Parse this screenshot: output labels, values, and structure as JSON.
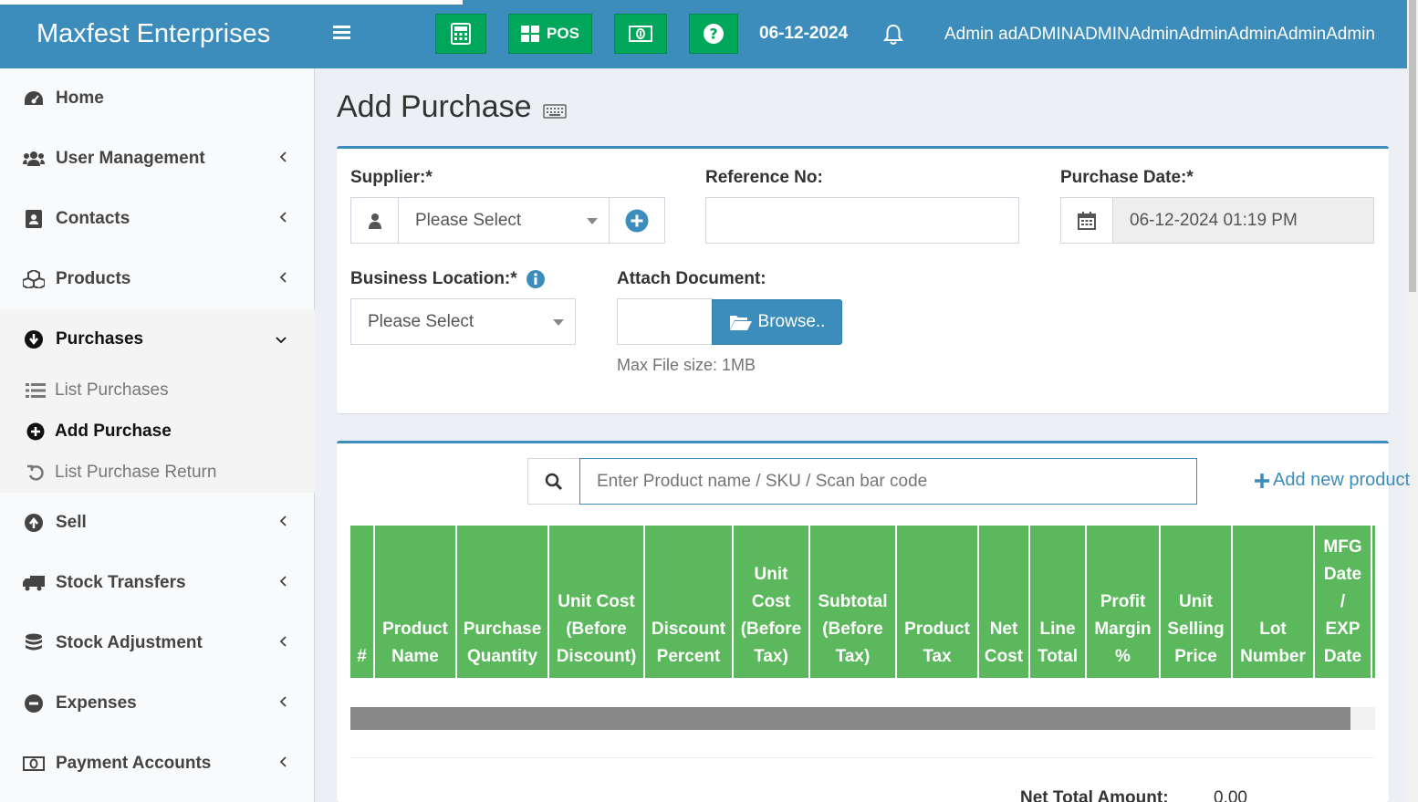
{
  "header": {
    "brand": "Maxfest Enterprises",
    "pos_label": "POS",
    "date": "06-12-2024",
    "user": "Admin adADMINADMINAdminAdminAdminAdminAdmin",
    "accent": "#3c8dbc",
    "button_color": "#00a65a"
  },
  "sidebar": {
    "items": [
      {
        "label": "Home",
        "icon": "dashboard-icon"
      },
      {
        "label": "User Management",
        "icon": "users-icon"
      },
      {
        "label": "Contacts",
        "icon": "address-book-icon"
      },
      {
        "label": "Products",
        "icon": "cubes-icon"
      },
      {
        "label": "Purchases",
        "icon": "arrow-circle-down-icon"
      },
      {
        "label": "Sell",
        "icon": "arrow-circle-up-icon"
      },
      {
        "label": "Stock Transfers",
        "icon": "truck-icon"
      },
      {
        "label": "Stock Adjustment",
        "icon": "database-icon"
      },
      {
        "label": "Expenses",
        "icon": "minus-circle-icon"
      },
      {
        "label": "Payment Accounts",
        "icon": "money-icon"
      }
    ],
    "purchases_sub": [
      {
        "label": "List Purchases",
        "icon": "list-icon"
      },
      {
        "label": "Add Purchase",
        "icon": "plus-circle-icon"
      },
      {
        "label": "List Purchase Return",
        "icon": "undo-icon"
      }
    ]
  },
  "page": {
    "title": "Add Purchase"
  },
  "form": {
    "supplier_label": "Supplier:*",
    "supplier_value": "Please Select",
    "reference_label": "Reference No:",
    "reference_value": "",
    "purchase_date_label": "Purchase Date:*",
    "purchase_date_value": "06-12-2024 01:19 PM",
    "location_label": "Business Location:*",
    "location_value": "Please Select",
    "attach_label": "Attach Document:",
    "browse_label": "Browse..",
    "max_file_help": "Max File size: 1MB"
  },
  "product_search": {
    "placeholder": "Enter Product name / SKU / Scan bar code",
    "add_new_label": "Add new product"
  },
  "table": {
    "columns": [
      [
        "#"
      ],
      [
        "Product",
        "Name"
      ],
      [
        "Purchase",
        "Quantity"
      ],
      [
        "Unit Cost",
        "(Before",
        "Discount)"
      ],
      [
        "Discount",
        "Percent"
      ],
      [
        "Unit",
        "Cost",
        "(Before",
        "Tax)"
      ],
      [
        "Subtotal",
        "(Before",
        "Tax)"
      ],
      [
        "Product",
        "Tax"
      ],
      [
        "Net",
        "Cost"
      ],
      [
        "Line",
        "Total"
      ],
      [
        "Profit",
        "Margin",
        "%"
      ],
      [
        "Unit",
        "Selling",
        "Price"
      ],
      [
        "Lot",
        "Number"
      ],
      [
        "MFG",
        "Date",
        "/",
        "EXP",
        "Date"
      ]
    ],
    "header_color": "#5cb85c"
  },
  "totals": {
    "net_total_label": "Net Total Amount:",
    "net_total_value": "0.00"
  }
}
